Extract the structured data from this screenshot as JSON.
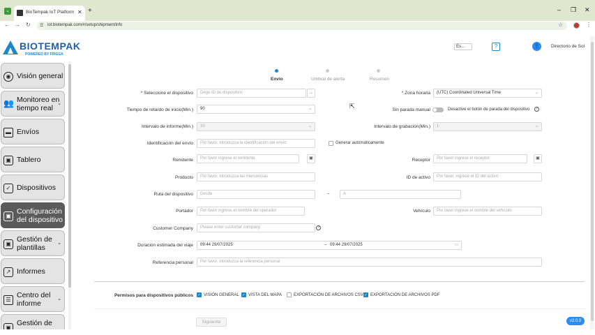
{
  "browser": {
    "tab_title": "BioTempak IoT Platform",
    "url": "iot.biotempak.com/#/setup/shipment/info"
  },
  "header": {
    "brand": "BIOTEMPAK",
    "brand_sub": "POWERED BY FRIGGA",
    "language": "Es...",
    "help": "?",
    "user_name": "Directorio de Sol"
  },
  "sidebar": {
    "items": [
      {
        "label": "Visión general",
        "icon": "eye-icon"
      },
      {
        "label": "Monitoreo en tiempo real",
        "icon": "group-icon"
      },
      {
        "label": "Envíos",
        "icon": "truck-icon"
      },
      {
        "label": "Tablero",
        "icon": "dashboard-icon"
      },
      {
        "label": "Dispositivos",
        "icon": "check-icon"
      },
      {
        "label": "Configuración del dispositivo",
        "icon": "settings-icon"
      },
      {
        "label": "Gestión de plantillas",
        "icon": "template-icon"
      },
      {
        "label": "Informes",
        "icon": "chart-icon"
      },
      {
        "label": "Centro del informe",
        "icon": "report-icon"
      },
      {
        "label": "Gestión de",
        "icon": "manage-icon"
      }
    ]
  },
  "steps": [
    {
      "label": "Envío"
    },
    {
      "label": "Umbral de alerta"
    },
    {
      "label": "Resumen"
    }
  ],
  "form": {
    "device_label": "* Seleccione el dispositivo",
    "device_placeholder": "Dege ID de dispositivo",
    "timezone_label": "* Zona horaria",
    "timezone_value": "(UTC) Coordinated Universal Time",
    "delay_label": "Tiempo de retardo de inicio(Min.)",
    "delay_value": "90",
    "manual_stop_label": "Sin parada manual",
    "manual_stop_desc": "Desactive el botón de parada del dispositivo",
    "report_interval_label": "Intervalo de informe(Min.)",
    "report_interval_value": "10",
    "record_interval_label": "Intervalo de grabación(Min.)",
    "record_interval_value": "1",
    "shipment_id_label": "Identificación del envío",
    "shipment_id_placeholder": "Por favor, introduzca la identificación del envío",
    "auto_generate_label": "Generar automáticamente",
    "sender_label": "Remitente",
    "sender_placeholder": "Por favor ingrese el remitente",
    "receiver_label": "Receptor",
    "receiver_placeholder": "Por favor ingrese el receptor",
    "product_label": "Producto",
    "product_placeholder": "Por favor, introduzca las mercancías",
    "asset_id_label": "ID de activo",
    "asset_id_placeholder": "Por favor, ingrese el ID del activo",
    "route_label": "Ruta del dispositivo",
    "route_from": "Desde",
    "route_sep": "–",
    "route_to": "A",
    "carrier_label": "Portador",
    "carrier_placeholder": "Por favor ingrese el nombre del operador",
    "vehicle_label": "Vehículo",
    "vehicle_placeholder": "Por favor ingrese el nombre del vehículo",
    "customer_label": "Customer Company",
    "customer_placeholder": "Please enter customer company",
    "duration_label": "Duración estimada del viaje",
    "duration_start": "09:44 29/07/2025",
    "duration_sep": "–",
    "duration_end": "09:44 29/07/2025",
    "reference_label": "Referencia personal",
    "reference_placeholder": "Por favor, introduzca la referencia personal"
  },
  "permissions": {
    "label": "Permisos para dispositivos públicos",
    "options": [
      {
        "label": "VISIÓN GENERAL",
        "checked": true
      },
      {
        "label": "VISTA DEL MAPA",
        "checked": true
      },
      {
        "label": "EXPORTACIÓN DE ARCHIVOS CSV",
        "checked": false
      },
      {
        "label": "EXPORTACIÓN DE ARCHIVOS PDF",
        "checked": true
      }
    ]
  },
  "footer": {
    "next_label": "Siguiente",
    "version": "v2.0.0"
  },
  "colors": {
    "accent": "#1e88c7",
    "active_nav": "#5a5a5a"
  }
}
